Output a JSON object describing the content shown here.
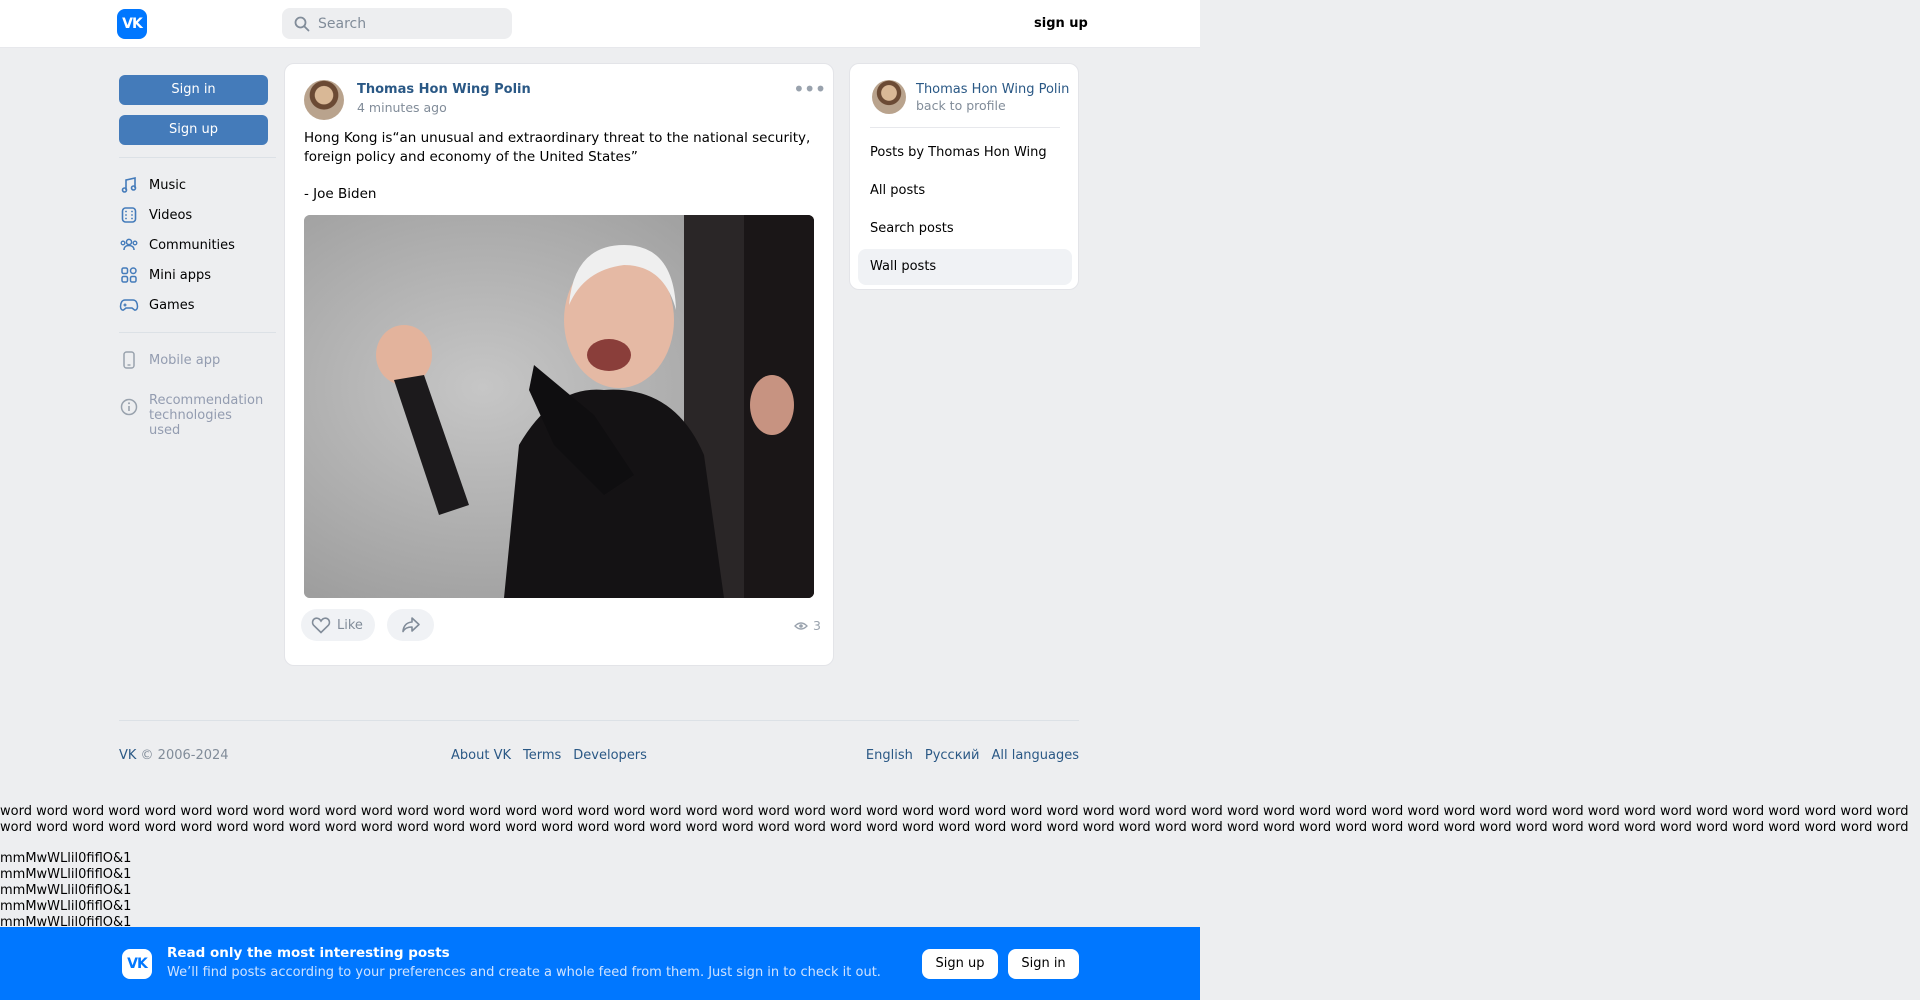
{
  "header": {
    "logo_text": "VK",
    "search_placeholder": "Search",
    "signup_label": "sign up"
  },
  "left_nav": {
    "signin_button": "Sign in",
    "signup_button": "Sign up",
    "items": [
      {
        "label": "Music",
        "icon": "music-icon"
      },
      {
        "label": "Videos",
        "icon": "video-icon"
      },
      {
        "label": "Communities",
        "icon": "communities-icon"
      },
      {
        "label": "Mini apps",
        "icon": "mini-apps-icon"
      },
      {
        "label": "Games",
        "icon": "gamepad-icon"
      }
    ],
    "mobile_app": "Mobile app",
    "recommendation": "Recommendation technologies used"
  },
  "post": {
    "author": "Thomas Hon Wing Polin",
    "time": "4 minutes ago",
    "text": "Hong Kong is“an unusual and extraordinary threat to the national security, foreign policy and economy of the United States”",
    "quote": "- Joe Biden",
    "like_label": "Like",
    "views": "3"
  },
  "side": {
    "name": "Thomas Hon Wing Polin",
    "back": "back to profile",
    "menu": [
      {
        "label": "Posts by Thomas Hon Wing",
        "active": false
      },
      {
        "label": "All posts",
        "active": false
      },
      {
        "label": "Search posts",
        "active": false
      },
      {
        "label": "Wall posts",
        "active": true
      }
    ]
  },
  "footer": {
    "copyright_brand": "VK",
    "copyright_rest": " © 2006-2024",
    "links": [
      "About VK",
      "Terms",
      "Developers"
    ],
    "languages": [
      "English",
      "Русский",
      "All languages"
    ]
  },
  "filler": {
    "word": "word",
    "mm_lines": [
      "mmMwWLlil0fiflO&1",
      "mmMwWLlil0fiflO&1",
      "mmMwWLlil0fiflO&1",
      "mmMwWLlil0fiflO&1",
      "mmMwWLlil0fiflO&1"
    ]
  },
  "banner": {
    "title": "Read only the most interesting posts",
    "subtitle": "We’ll find posts according to your preferences and create a whole feed from them. Just sign in to check it out.",
    "signup": "Sign up",
    "signin": "Sign in"
  },
  "colors": {
    "brand": "#0077ff",
    "button_blue": "#447bba",
    "link": "#2a5885",
    "page_bg": "#edeef0"
  }
}
